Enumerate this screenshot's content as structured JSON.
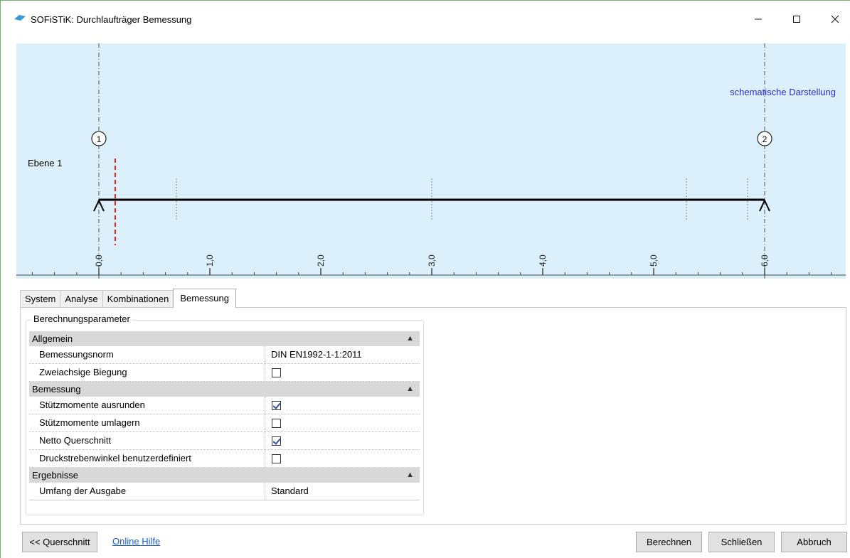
{
  "window": {
    "title": "SOFiSTiK: Durchlaufträger Bemessung",
    "minimize": "–",
    "maximize": "☐",
    "close": "✕"
  },
  "diagram": {
    "schematic_label": "schematische Darstellung",
    "level_label": "Ebene 1",
    "supports": [
      "1",
      "2"
    ],
    "axis_ticks": [
      "0,0",
      "1,0",
      "2,0",
      "3,0",
      "4,0",
      "5,0",
      "6,0"
    ],
    "colors": {
      "background": "#dcf0fb",
      "beam": "#000000",
      "marker": "#e02020"
    }
  },
  "tabs": [
    {
      "label": "System",
      "active": false
    },
    {
      "label": "Analyse",
      "active": false
    },
    {
      "label": "Kombinationen",
      "active": false
    },
    {
      "label": "Bemessung",
      "active": true
    }
  ],
  "params": {
    "group_title": "Berechnungsparameter",
    "categories": [
      {
        "name": "Allgemein",
        "rows": [
          {
            "label": "Bemessungsnorm",
            "value": "DIN EN1992-1-1:2011"
          },
          {
            "label": "Zweiachsige Biegung",
            "checked": false
          }
        ]
      },
      {
        "name": "Bemessung",
        "rows": [
          {
            "label": "Stützmomente ausrunden",
            "checked": true
          },
          {
            "label": "Stützmomente umlagern",
            "checked": false
          },
          {
            "label": "Netto Querschnitt",
            "checked": true
          },
          {
            "label": "Druckstrebenwinkel benutzerdefiniert",
            "checked": false
          }
        ]
      },
      {
        "name": "Ergebnisse",
        "rows": [
          {
            "label": "Umfang der Ausgabe",
            "value": "Standard"
          }
        ]
      }
    ]
  },
  "footer": {
    "querschnitt": "<< Querschnitt",
    "help_link": "Online Hilfe",
    "berechnen": "Berechnen",
    "schliessen": "Schließen",
    "abbruch": "Abbruch"
  }
}
